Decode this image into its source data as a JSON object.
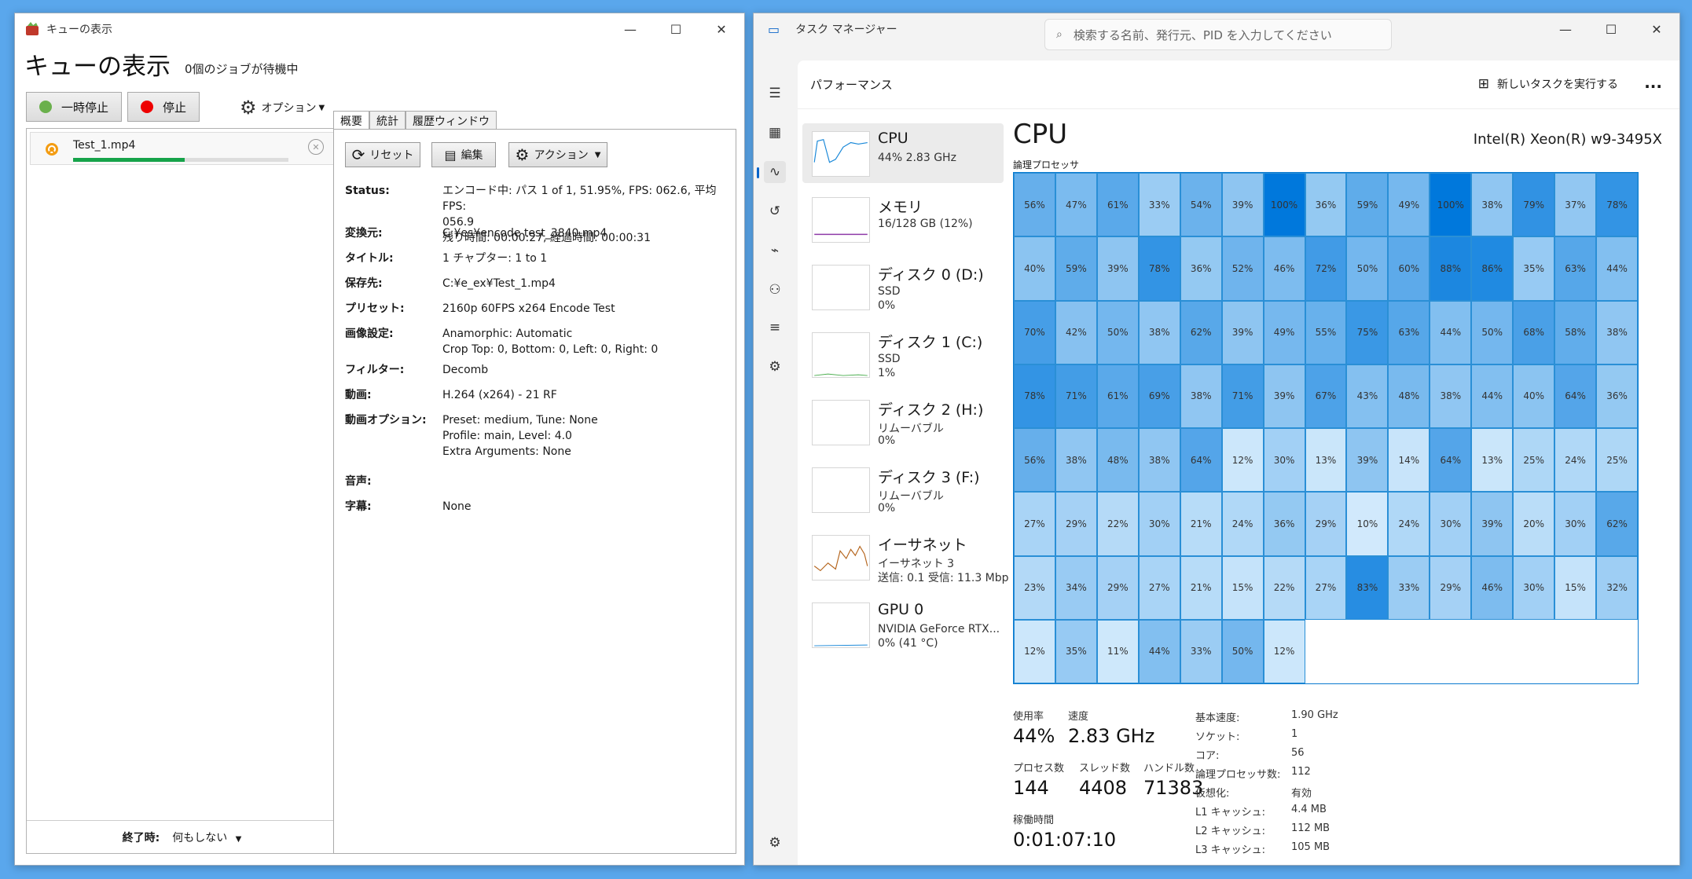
{
  "handbrake": {
    "title": "キューの表示",
    "heading": "キューの表示",
    "jobs_waiting": "0個のジョブが待機中",
    "pause_label": "一時停止",
    "stop_label": "停止",
    "options_label": "オプション",
    "queue_item": {
      "name": "Test_1.mp4",
      "progress": 0.5195
    },
    "when_done_label": "終了時:",
    "when_done_value": "何もしない",
    "tabs": [
      "概要",
      "統計",
      "履歴ウィンドウ"
    ],
    "reset_label": "リセット",
    "edit_label": "編集",
    "action_label": "アクション",
    "details": [
      {
        "k": "Status:",
        "v": [
          "エンコード中: パス 1 of 1,  51.95%, FPS: 062.6,  平均FPS:",
          "056.9",
          "残り時間: 00:00:27,  経過時間: 00:00:31"
        ]
      },
      {
        "k": "変換元:",
        "v": [
          "C:¥es¥encode test_3840.mp4"
        ]
      },
      {
        "k": "タイトル:",
        "v": [
          "1   チャプター:  1 to 1"
        ]
      },
      {
        "k": "保存先:",
        "v": [
          "C:¥e_ex¥Test_1.mp4"
        ]
      },
      {
        "k": "プリセット:",
        "v": [
          "2160p 60FPS x264 Encode Test"
        ]
      },
      {
        "k": "画像設定:",
        "v": [
          "Anamorphic: Automatic",
          "Crop Top: 0, Bottom: 0, Left: 0, Right: 0"
        ]
      },
      {
        "k": "フィルター:",
        "v": [
          "Decomb"
        ]
      },
      {
        "k": "動画:",
        "v": [
          "H.264 (x264) - 21 RF"
        ]
      },
      {
        "k": "動画オプション:",
        "v": [
          "Preset: medium, Tune: None",
          "Profile: main, Level: 4.0",
          "Extra Arguments: None"
        ]
      },
      {
        "k": "音声:",
        "v": [
          ""
        ]
      },
      {
        "k": "字幕:",
        "v": [
          "None"
        ]
      }
    ]
  },
  "taskmgr": {
    "title": "タスク マネージャー",
    "search_placeholder": "検索する名前、発行元、PID を入力してください",
    "section": "パフォーマンス",
    "run_task_label": "新しいタスクを実行する",
    "more_label": "...",
    "side": [
      {
        "name": "CPU",
        "sub": [
          "44%  2.83 GHz"
        ]
      },
      {
        "name": "メモリ",
        "sub": [
          "16/128 GB (12%)"
        ]
      },
      {
        "name": "ディスク 0 (D:)",
        "sub": [
          "SSD",
          "0%"
        ]
      },
      {
        "name": "ディスク 1 (C:)",
        "sub": [
          "SSD",
          "1%"
        ]
      },
      {
        "name": "ディスク 2 (H:)",
        "sub": [
          "リムーバブル",
          "0%"
        ]
      },
      {
        "name": "ディスク 3 (F:)",
        "sub": [
          "リムーバブル",
          "0%"
        ]
      },
      {
        "name": "イーサネット",
        "sub": [
          "イーサネット 3",
          "送信: 0.1  受信: 11.3 Mbp"
        ]
      },
      {
        "name": "GPU 0",
        "sub": [
          "NVIDIA GeForce RTX...",
          "0% (41 °C)"
        ]
      }
    ],
    "cpu_title": "CPU",
    "cpu_model": "Intel(R) Xeon(R) w9-3495X",
    "logical_label": "論理プロセッサ",
    "core_loads": [
      56,
      47,
      61,
      33,
      54,
      39,
      100,
      36,
      59,
      49,
      100,
      38,
      79,
      37,
      78,
      40,
      59,
      39,
      78,
      36,
      52,
      46,
      72,
      50,
      60,
      88,
      86,
      35,
      63,
      44,
      70,
      42,
      50,
      38,
      62,
      39,
      49,
      55,
      75,
      63,
      44,
      50,
      68,
      58,
      38,
      78,
      71,
      61,
      69,
      38,
      71,
      39,
      67,
      43,
      48,
      38,
      44,
      40,
      64,
      36,
      56,
      38,
      48,
      38,
      64,
      12,
      30,
      13,
      39,
      14,
      64,
      13,
      25,
      24,
      25,
      27,
      29,
      22,
      30,
      21,
      24,
      36,
      29,
      10,
      24,
      30,
      39,
      20,
      30,
      62,
      23,
      34,
      29,
      27,
      21,
      15,
      22,
      27,
      83,
      33,
      29,
      46,
      30,
      15,
      32,
      12,
      35,
      11,
      44,
      33,
      50,
      12
    ],
    "stats": {
      "usage_label": "使用率",
      "usage": "44%",
      "speed_label": "速度",
      "speed": "2.83 GHz",
      "proc_label": "プロセス数",
      "proc": "144",
      "thread_label": "スレッド数",
      "thread": "4408",
      "handle_label": "ハンドル数",
      "handle": "71383",
      "uptime_label": "稼働時間",
      "uptime": "0:01:07:10"
    },
    "specs": [
      {
        "k": "基本速度:",
        "v": "1.90 GHz"
      },
      {
        "k": "ソケット:",
        "v": "1"
      },
      {
        "k": "コア:",
        "v": "56"
      },
      {
        "k": "論理プロセッサ数:",
        "v": "112"
      },
      {
        "k": "仮想化:",
        "v": "有効"
      },
      {
        "k": "L1 キャッシュ:",
        "v": "4.4 MB"
      },
      {
        "k": "L2 キャッシュ:",
        "v": "112 MB"
      },
      {
        "k": "L3 キャッシュ:",
        "v": "105 MB"
      }
    ]
  }
}
